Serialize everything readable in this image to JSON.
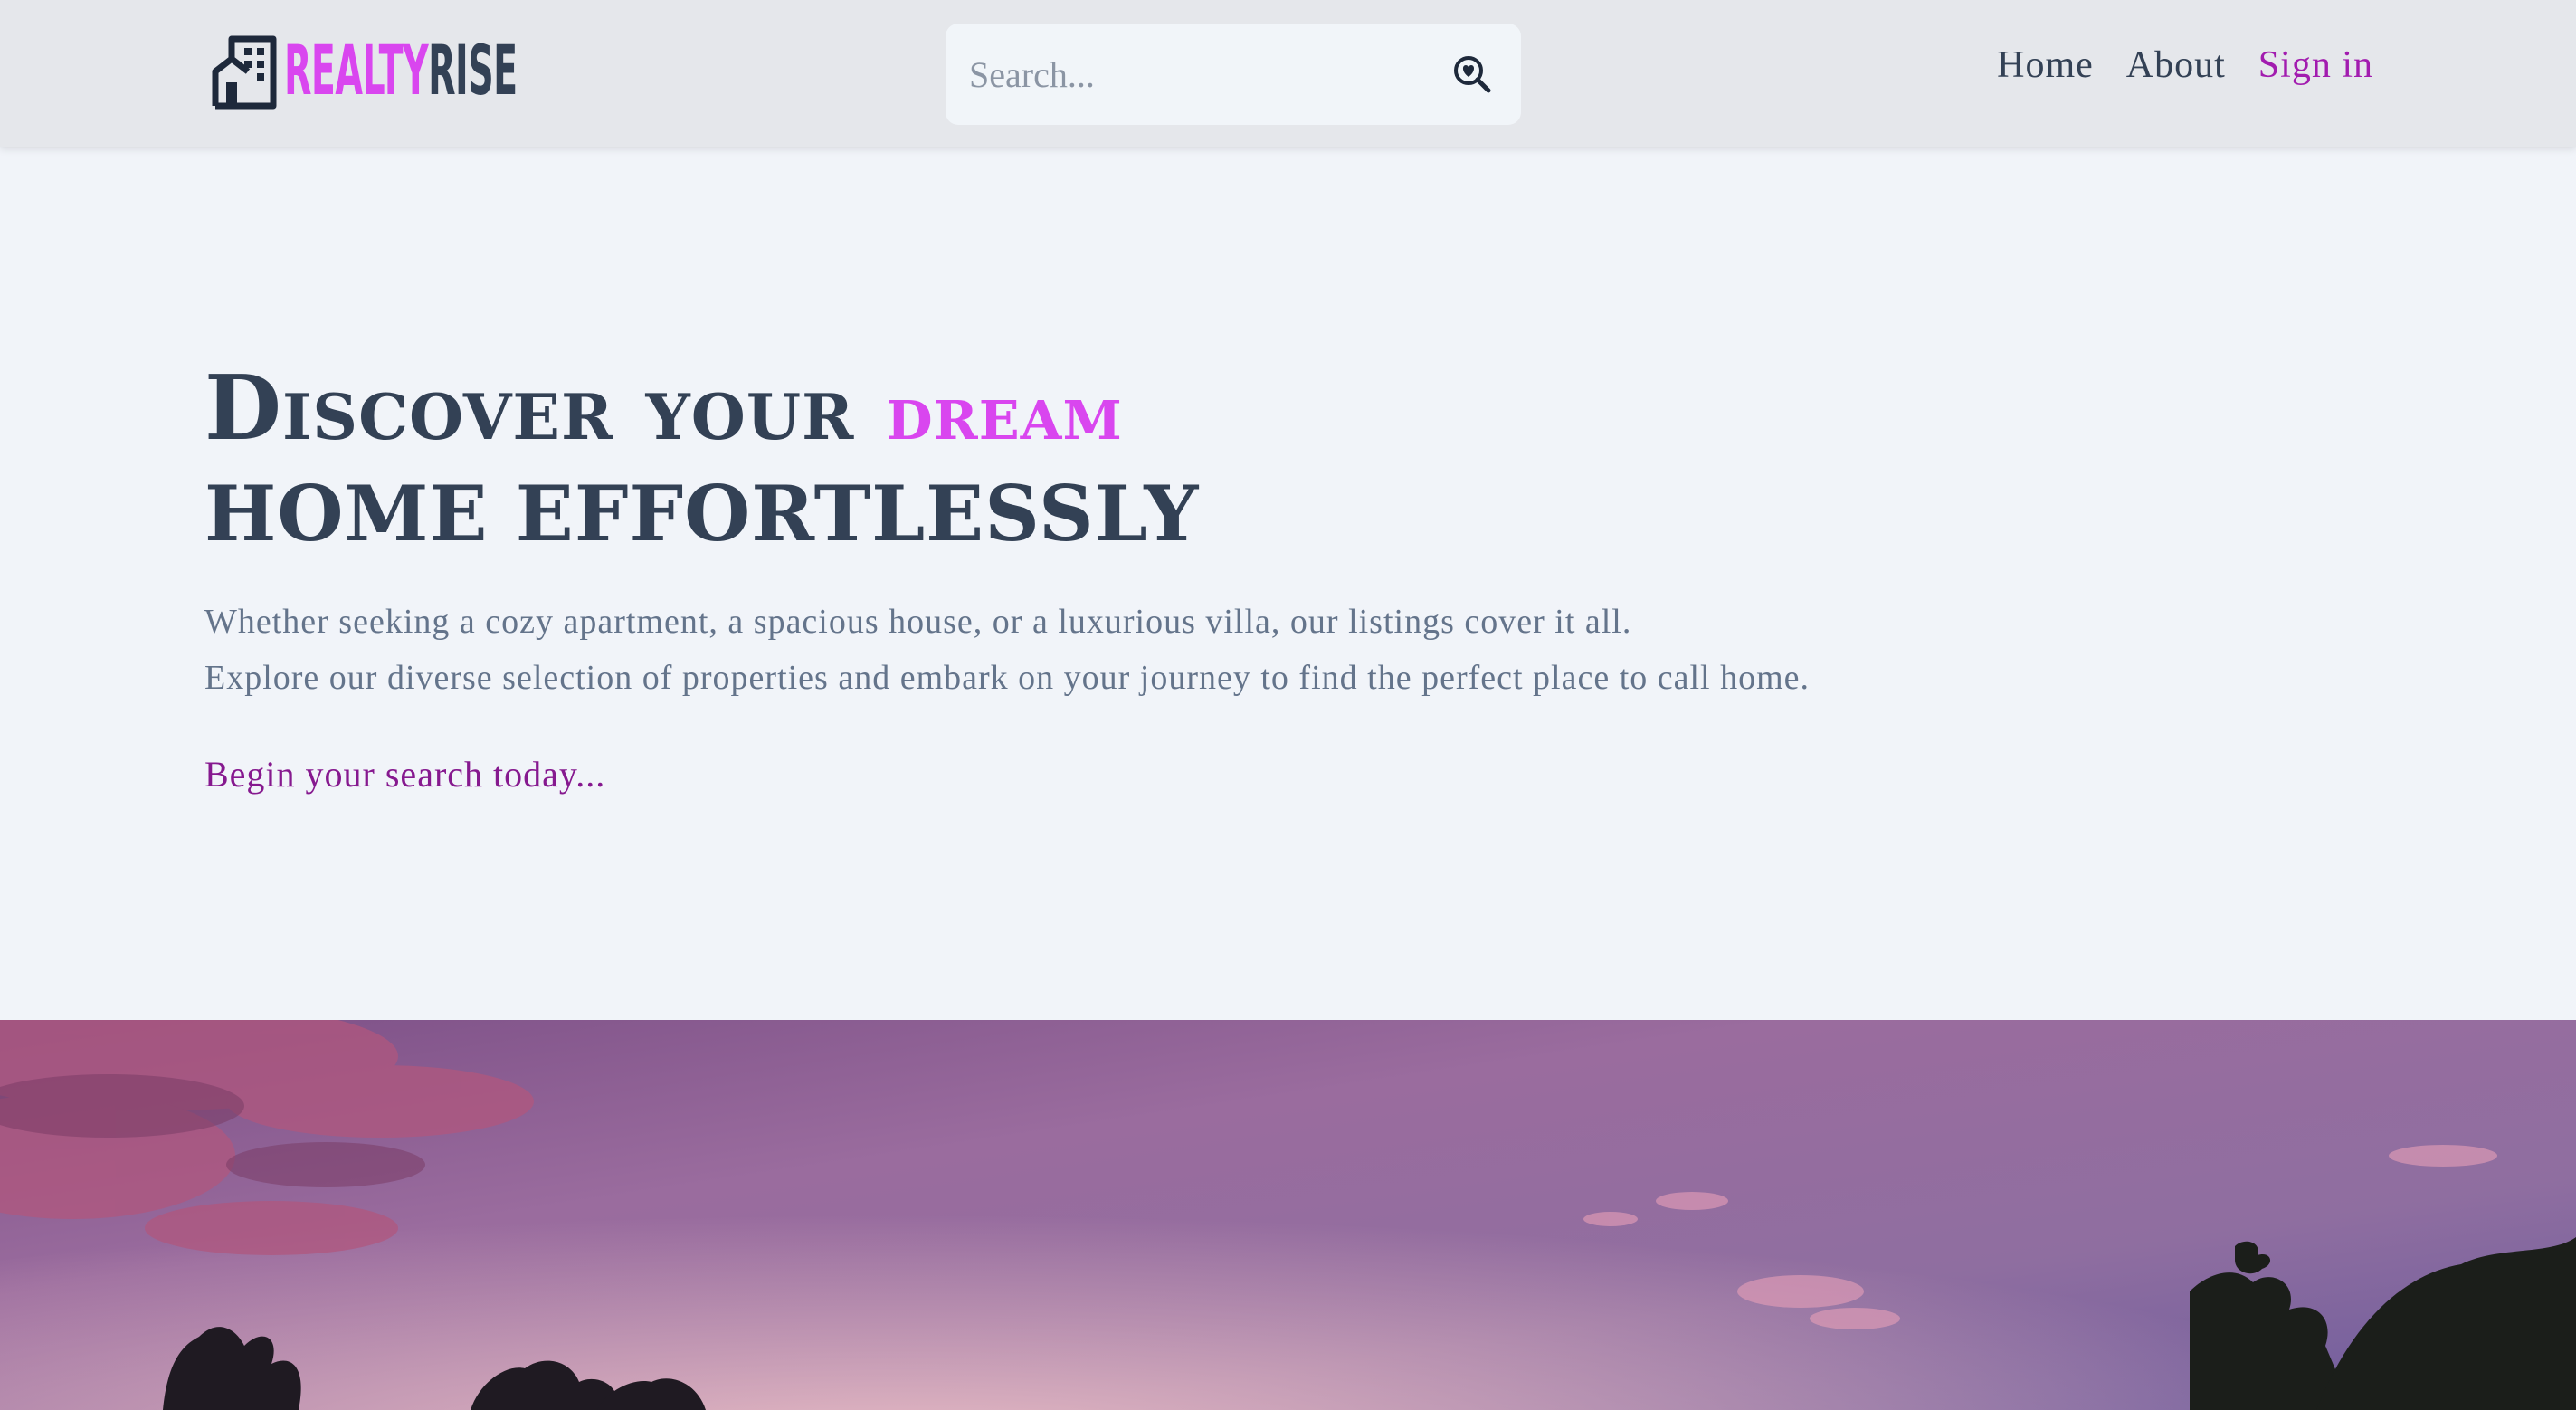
{
  "header": {
    "logo": {
      "text_part1": "REALTY",
      "text_part2": "RISE",
      "icon": "building-icon"
    },
    "search": {
      "placeholder": "Search...",
      "value": "",
      "icon": "search-heart-icon"
    },
    "nav": [
      {
        "label": "Home"
      },
      {
        "label": "About"
      },
      {
        "label": "Sign in"
      }
    ]
  },
  "hero": {
    "title_line1_prefix": "Discover your",
    "title_line1_accent": "dream",
    "title_line2": "home effortlessly",
    "description_line1": "Whether seeking a cozy apartment, a spacious house, or a luxurious villa, our listings cover it all.",
    "description_line2": "Explore our diverse selection of properties and embark on your journey to find the perfect place to call home.",
    "cta": "Begin your search today..."
  },
  "banner": {
    "image": "sunset-sky-with-trees"
  },
  "colors": {
    "accent": "#d946ef",
    "accent_dark": "#a21caf",
    "text_primary": "#334155",
    "text_muted": "#64748b",
    "header_bg": "#e5e7eb",
    "page_bg": "#f1f4f9"
  }
}
